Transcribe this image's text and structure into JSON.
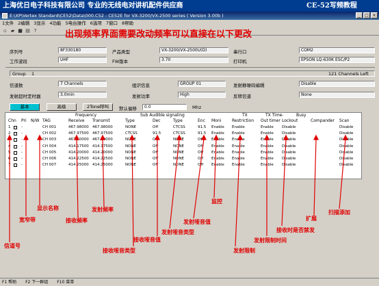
{
  "banner": {
    "left": "上海优日电子科技有限公司 专业的无线电对讲机配件供应商",
    "right": "CE-52写频教程"
  },
  "window": {
    "title": "E:\\XP\\Vertex Standard\\CE52\\Data\\000.C52 - CE52E for VX-3200/VX-2500 series ( Version 3.00b )"
  },
  "menu": [
    "1文件",
    "2编辑",
    "3显示",
    "4功能",
    "5电台操作",
    "6选项",
    "7窗口",
    "8帮助"
  ],
  "overlay": "出现频率界面需要改动频率可以直接在以下更改",
  "info": {
    "serial_label": "序列号",
    "serial_value": "8F330180",
    "product_label": "产品类型",
    "product_value": "VX-3200/VX-2500U(D)",
    "com_label": "串行口",
    "com_value": "COM2",
    "band_label": "工作波段",
    "band_value": "UHF",
    "fw_label": "FW版本",
    "fw_value": "3.70",
    "printer_label": "打印机",
    "printer_value": "EPSON LQ-630K ESC/P2"
  },
  "group": {
    "label": "Group",
    "num": "1",
    "channels_left": "121 Channels Left"
  },
  "settings": {
    "count_label": "信道数",
    "count_value": "7 Channels",
    "group_label": "组识信息",
    "group_value": "GROUP 01",
    "scramble_label": "发射静噪码编辑",
    "scramble_value": "Disable",
    "tot_label": "发射超时定时器",
    "tot_value": "3.0min",
    "power_label": "发射功率",
    "power_value": "High",
    "reverse_label": "反转信道",
    "reverse_value": "None"
  },
  "tabs": {
    "basic": "基本",
    "advanced": "高级",
    "twotone": "2Tone呼叫",
    "default_label": "默认偏移",
    "offset_value": "0.0",
    "offset_unit": "Mhz"
  },
  "table": {
    "group_headers": {
      "frequency": "Frequency",
      "subaudible": "Sub Audible signaling",
      "tx": "TX",
      "txtime": "TX Time-",
      "busy": "Busy"
    },
    "columns": [
      "Chn",
      "Pri",
      "N/W",
      "TAG",
      "Receive",
      "Transmit",
      "Type",
      "Dec",
      "Type",
      "Enc",
      "Moni",
      "Restriction",
      "Out timer",
      "Lockout",
      "Compander",
      "Scan"
    ],
    "rows": [
      [
        "1",
        "-",
        "",
        "CH 001",
        "467.98000",
        "467.98000",
        "NONE",
        "Off",
        "CTCSS",
        "91.5",
        "Enable",
        "Enable",
        "Enable",
        "Disable",
        "",
        "Disable"
      ],
      [
        "2",
        "-",
        "",
        "CH 002",
        "467.97500",
        "467.97500",
        "CTCSS",
        "91.5",
        "CTCSS",
        "91.5",
        "Enable",
        "Enable",
        "Enable",
        "Disable",
        "",
        "Disable"
      ],
      [
        "3",
        "-",
        "",
        "CH 003",
        "467.50000",
        "467.50000",
        "NONE",
        "Off",
        "NONE",
        "Off",
        "Enable",
        "Enable",
        "Enable",
        "Disable",
        "",
        "Disable"
      ],
      [
        "4",
        "-",
        "",
        "CH 004",
        "414.17500",
        "414.17500",
        "NONE",
        "Off",
        "NONE",
        "Off",
        "Enable",
        "Enable",
        "Enable",
        "Disable",
        "",
        "Disable"
      ],
      [
        "5",
        "-",
        "",
        "CH 005",
        "414.20000",
        "414.20000",
        "NONE",
        "Off",
        "NONE",
        "Off",
        "Enable",
        "Enable",
        "Enable",
        "Disable",
        "",
        "Disable"
      ],
      [
        "6",
        "-",
        "",
        "CH 006",
        "414.22500",
        "414.22500",
        "NONE",
        "Off",
        "NONE",
        "Off",
        "Enable",
        "Enable",
        "Enable",
        "Disable",
        "",
        "Disable"
      ],
      [
        "7",
        "-",
        "",
        "CH 007",
        "414.25000",
        "414.25000",
        "NONE",
        "Off",
        "NONE",
        "Off",
        "Enable",
        "Enable",
        "Enable",
        "Disable",
        "",
        "Disable"
      ]
    ]
  },
  "callouts": {
    "chn": "信道号",
    "nw": "宽窄带",
    "tag": "显示名称",
    "rx": "接收频率",
    "tx": "发射频率",
    "rx_type": "接收哑音类型",
    "rx_val": "接收哑音值",
    "tx_type": "发射哑音类型",
    "tx_val": "发射哑音值",
    "moni": "监控",
    "restrict": "发射限制",
    "tot": "发射限制时间",
    "busy": "接收时是否禁发",
    "compander": "扩展",
    "scan": "扫描添加"
  },
  "status": [
    "F1 帮助",
    "F2 下一群组",
    "F10 菜单"
  ]
}
